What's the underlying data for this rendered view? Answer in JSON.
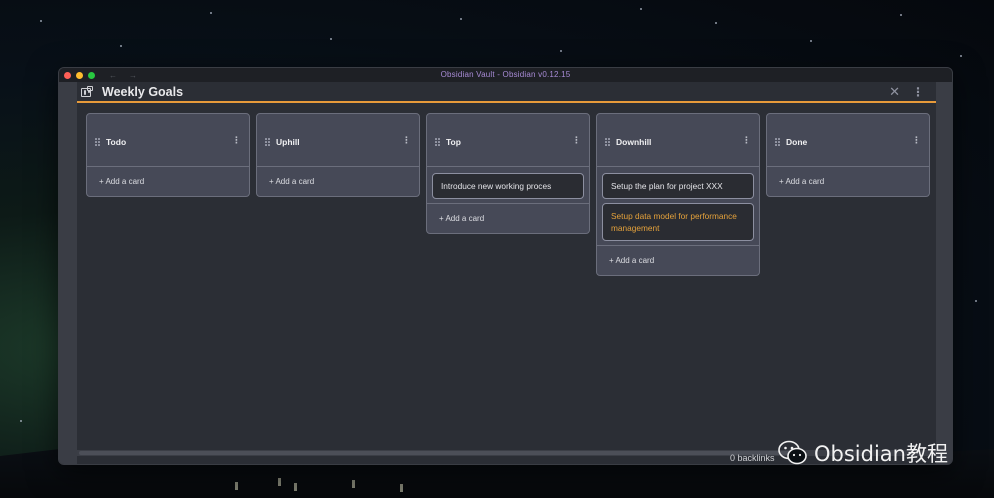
{
  "window": {
    "title": "Obsidian Vault - Obsidian v0.12.15",
    "back_arrow": "←",
    "forward_arrow": "→"
  },
  "header": {
    "title": "Weekly Goals",
    "close_icon": "✕",
    "more_icon": "⋮"
  },
  "lanes": [
    {
      "title": "Todo",
      "cards": [],
      "add_label": "+ Add a card"
    },
    {
      "title": "Uphill",
      "cards": [],
      "add_label": "+ Add a card"
    },
    {
      "title": "Top",
      "cards": [
        "Introduce new working proces"
      ],
      "add_label": "+ Add a card"
    },
    {
      "title": "Downhill",
      "cards": [
        "Setup the plan for project XXX",
        "Setup data model for performance management"
      ],
      "add_label": "+ Add a card"
    },
    {
      "title": "Done",
      "cards": [],
      "add_label": "+ Add a card"
    }
  ],
  "status": {
    "backlinks": "0 backlinks"
  },
  "watermark": {
    "text": "Obsidian教程"
  },
  "colors": {
    "accent": "#e79a3a",
    "card_highlight": "#e5a23b"
  }
}
